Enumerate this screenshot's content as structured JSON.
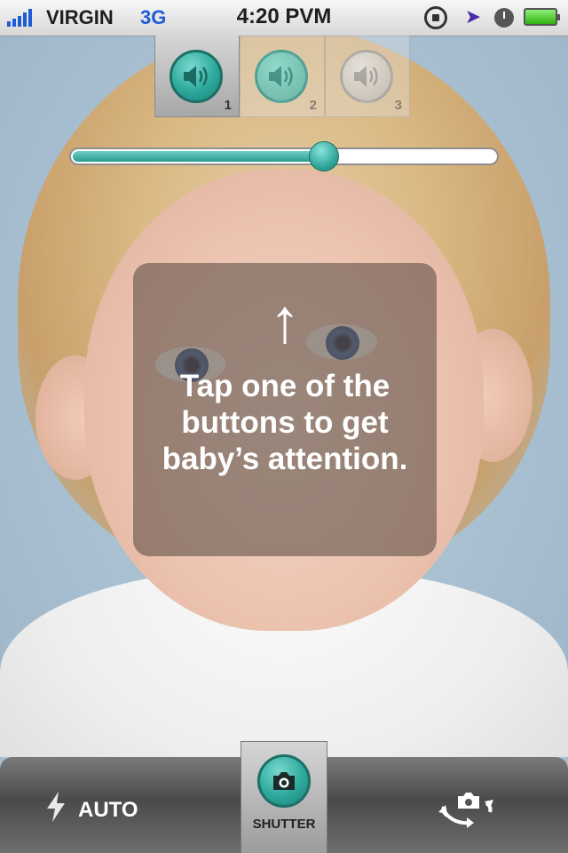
{
  "status_bar": {
    "carrier": "VIRGIN",
    "network": "3G",
    "time": "4:20 PVM",
    "icons": [
      "signal-icon",
      "rotation-lock-icon",
      "location-icon",
      "alarm-icon",
      "battery-icon"
    ]
  },
  "sound_buttons": [
    {
      "number": "1",
      "icon": "speaker-icon",
      "state": "selected"
    },
    {
      "number": "2",
      "icon": "speaker-icon",
      "state": "inactive"
    },
    {
      "number": "3",
      "icon": "speaker-icon",
      "state": "inactive"
    }
  ],
  "volume_slider": {
    "value_fraction": 0.59
  },
  "hint": {
    "arrow": "↑",
    "text": "Tap one of the buttons to get baby’s attention."
  },
  "toolbar": {
    "flash_label": "AUTO",
    "flash_icon": "lightning-icon",
    "shutter_label": "SHUTTER",
    "shutter_icon": "camera-icon",
    "switch_icon": "switch-camera-icon"
  },
  "colors": {
    "accent_teal": "#2da99c",
    "status_blue": "#1f5bd4",
    "battery_green": "#2fb20f"
  }
}
